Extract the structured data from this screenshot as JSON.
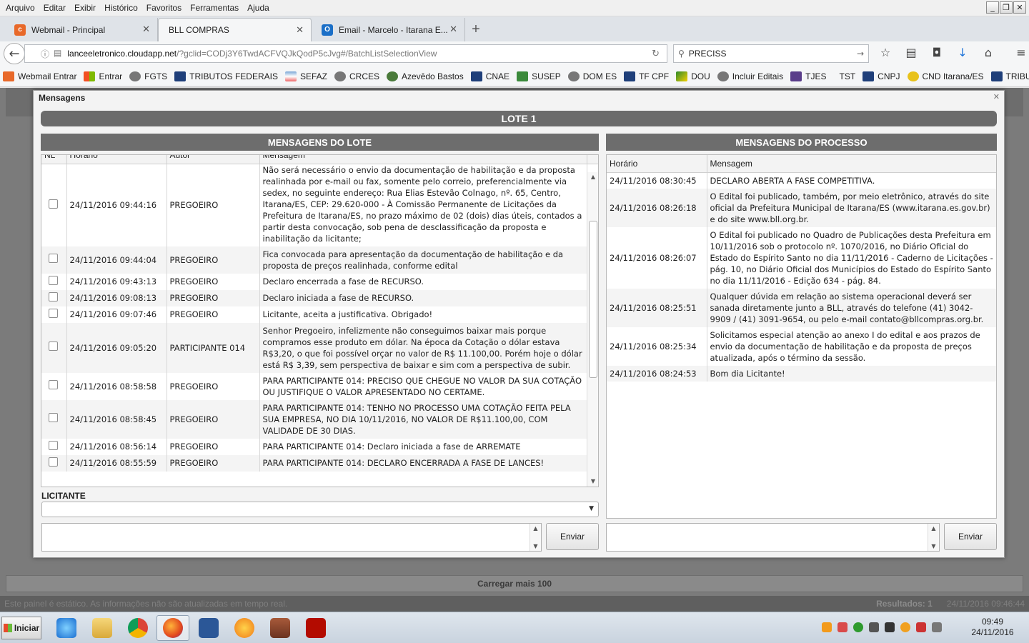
{
  "menubar": {
    "items": [
      "Arquivo",
      "Editar",
      "Exibir",
      "Histórico",
      "Favoritos",
      "Ferramentas",
      "Ajuda"
    ]
  },
  "tabs": [
    {
      "label": "Webmail - Principal",
      "icon": "cpanel-icon"
    },
    {
      "label": "BLL COMPRAS",
      "icon": "page-icon"
    },
    {
      "label": "Email - Marcelo - Itarana E...",
      "icon": "outlook-icon"
    }
  ],
  "address": {
    "host": "lanceeletronico.cloudapp.net",
    "path": "/?gclid=CODj3Y6TwdACFVQJkQodP5cJvg#/BatchListSelectionView"
  },
  "search": {
    "value": "PRECISS"
  },
  "bookmarks": [
    "Webmail Entrar",
    "Entrar",
    "FGTS",
    "TRIBUTOS FEDERAIS",
    "SEFAZ",
    "CRCES",
    "Azevêdo Bastos",
    "CNAE",
    "SUSEP",
    "DOM ES",
    "TF CPF",
    "DOU",
    "Incluir Editais",
    "TJES",
    "TST",
    "CNPJ",
    "CND Itarana/ES",
    "TRIBUTO FEDERAL"
  ],
  "modal": {
    "title": "Mensagens",
    "lote_title": "LOTE 1",
    "lote_section": "MENSAGENS DO LOTE",
    "processo_section": "MENSAGENS DO PROCESSO",
    "lote_columns": {
      "nl": "NL",
      "horario": "Horário",
      "autor": "Autor",
      "mensagem": "Mensagem"
    },
    "processo_columns": {
      "horario": "Horário",
      "mensagem": "Mensagem"
    },
    "licitante_label": "LICITANTE",
    "send_label": "Enviar",
    "lote_messages": [
      {
        "time": "24/11/2016 09:44:16",
        "author": "PREGOEIRO",
        "text": "Não será necessário o envio da documentação de habilitação e da proposta realinhada por e-mail ou fax, somente pelo correio, preferencialmente via sedex, no seguinte endereço: Rua Elias Estevão Colnago, nº. 65, Centro, Itarana/ES, CEP: 29.620-000 - À Comissão Permanente de Licitações da Prefeitura de Itarana/ES, no prazo máximo de 02 (dois) dias úteis, contados a partir desta convocação, sob pena de desclassificação da proposta e inabilitação da licitante;"
      },
      {
        "time": "24/11/2016 09:44:04",
        "author": "PREGOEIRO",
        "text": "Fica convocada para apresentação da documentação de habilitação e da proposta de preços realinhada, conforme edital"
      },
      {
        "time": "24/11/2016 09:43:13",
        "author": "PREGOEIRO",
        "text": "Declaro encerrada a fase de RECURSO."
      },
      {
        "time": "24/11/2016 09:08:13",
        "author": "PREGOEIRO",
        "text": "Declaro iniciada a fase de RECURSO."
      },
      {
        "time": "24/11/2016 09:07:46",
        "author": "PREGOEIRO",
        "text": "Licitante, aceita a justificativa. Obrigado!"
      },
      {
        "time": "24/11/2016 09:05:20",
        "author": "PARTICIPANTE 014",
        "text": "Senhor Pregoeiro, infelizmente não conseguimos baixar mais porque compramos esse produto em dólar. Na época da Cotação o dólar estava R$3,20, o que foi possível orçar no valor de R$ 11.100,00. Porém hoje o dólar está R$ 3,39, sem perspectiva de baixar e sim com a perspectiva de subir."
      },
      {
        "time": "24/11/2016 08:58:58",
        "author": "PREGOEIRO",
        "text": "PARA PARTICIPANTE 014: PRECISO QUE CHEGUE NO VALOR DA SUA COTAÇÃO OU JUSTIFIQUE O VALOR APRESENTADO NO CERTAME."
      },
      {
        "time": "24/11/2016 08:58:45",
        "author": "PREGOEIRO",
        "text": "PARA PARTICIPANTE 014: TENHO NO PROCESSO UMA COTAÇÃO FEITA PELA SUA EMPRESA, NO DIA 10/11/2016, NO VALOR DE R$11.100,00, COM VALIDADE DE 30 DIAS."
      },
      {
        "time": "24/11/2016 08:56:14",
        "author": "PREGOEIRO",
        "text": "PARA PARTICIPANTE 014: Declaro iniciada a fase de ARREMATE"
      },
      {
        "time": "24/11/2016 08:55:59",
        "author": "PREGOEIRO",
        "text": "PARA PARTICIPANTE 014: DECLARO ENCERRADA A FASE DE LANCES!"
      }
    ],
    "processo_messages": [
      {
        "time": "24/11/2016 08:30:45",
        "text": "DECLARO ABERTA A FASE COMPETITIVA."
      },
      {
        "time": "24/11/2016 08:26:18",
        "text": "O Edital foi publicado, também, por meio eletrônico, através do site oficial da Prefeitura Municipal de Itarana/ES (www.itarana.es.gov.br) e do site www.bll.org.br."
      },
      {
        "time": "24/11/2016 08:26:07",
        "text": "O Edital foi publicado no Quadro de Publicações desta Prefeitura em 10/11/2016 sob o protocolo nº. 1070/2016, no Diário Oficial do Estado do Espírito Santo no dia 11/11/2016 - Caderno de Licitações - pág. 10, no Diário Oficial dos Municípios do Estado do Espírito Santo no dia 11/11/2016 - Edição 634 - pág. 84."
      },
      {
        "time": "24/11/2016 08:25:51",
        "text": "Qualquer dúvida em relação ao sistema operacional deverá ser sanada diretamente junto a BLL, através do telefone (41) 3042-9909 / (41) 3091-9654, ou pelo e-mail contato@bllcompras.org.br."
      },
      {
        "time": "24/11/2016 08:25:34",
        "text": "Solicitamos especial atenção ao anexo I do edital e aos prazos de envio da documentação de habilitação e da proposta de preços atualizada, após o término da sessão."
      },
      {
        "time": "24/11/2016 08:24:53",
        "text": "Bom dia Licitante!"
      }
    ]
  },
  "page": {
    "load_more": "Carregar mais 100",
    "status_text": "Este painel é estático. As informações não são atualizadas em tempo real.",
    "results": "Resultados: 1",
    "status_time": "24/11/2016 09:46:44"
  },
  "taskbar": {
    "start": "Iniciar",
    "time": "09:49",
    "date": "24/11/2016"
  },
  "colors": {
    "section_header": "#6d6d6d",
    "lote_header": "#6b6b6b",
    "overlay": "#7b7b7b"
  }
}
